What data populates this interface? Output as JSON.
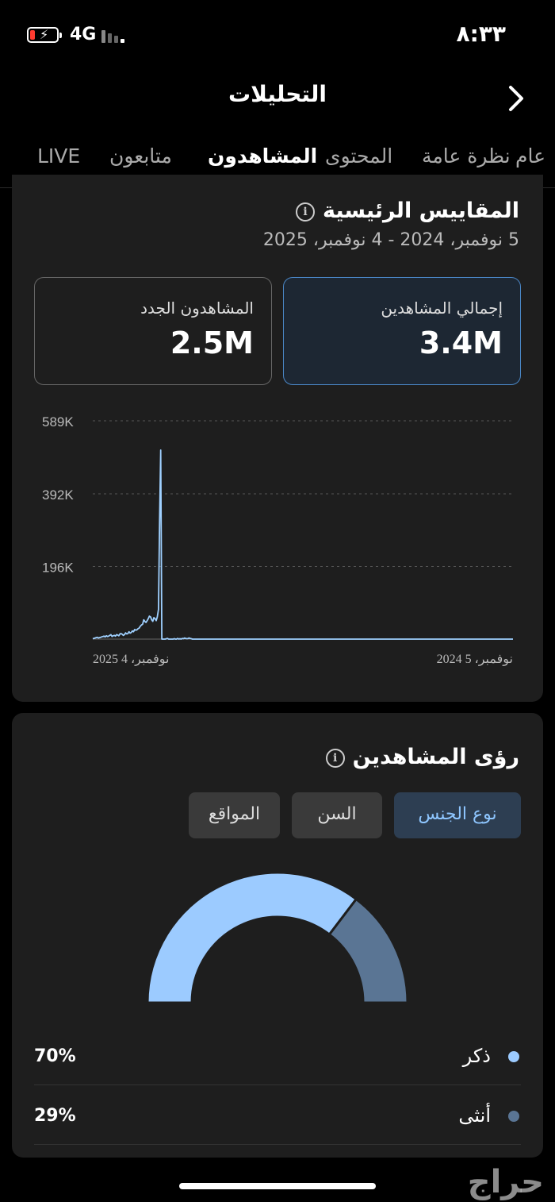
{
  "status": {
    "network": "4G",
    "time": "٨:٣٣"
  },
  "header": {
    "title": "التحليلات"
  },
  "tabs": [
    {
      "label": "عام"
    },
    {
      "label": "نظرة عامة"
    },
    {
      "label": "المحتوى"
    },
    {
      "label": "المشاهدون",
      "active": true
    },
    {
      "label": "متابعون"
    },
    {
      "label": "LIVE"
    }
  ],
  "metrics": {
    "title": "المقاييس الرئيسية",
    "date_range": "5 نوفمبر، 2024 - 4 نوفمبر، 2025",
    "cards": [
      {
        "label": "إجمالي المشاهدين",
        "value": "3.4M",
        "selected": true
      },
      {
        "label": "المشاهدون الجدد",
        "value": "2.5M",
        "selected": false
      }
    ]
  },
  "chart_data": {
    "type": "line",
    "title": "",
    "ylim": [
      0,
      589000
    ],
    "y_ticks": [
      {
        "value": 589000,
        "label": "589K"
      },
      {
        "value": 392000,
        "label": "392K"
      },
      {
        "value": 196000,
        "label": "196K"
      }
    ],
    "x_tick_labels": [
      "نوفمبر، 5 2024",
      "نوفمبر، 4 2025"
    ],
    "x_direction": "rtl",
    "color": "#9fd0ff",
    "series": [
      {
        "values": [
          0,
          0,
          0,
          0,
          0,
          0,
          0,
          0,
          0,
          0,
          0,
          0,
          0,
          0,
          0,
          0,
          0,
          0,
          0,
          0,
          0,
          0,
          0,
          0,
          0,
          0,
          0,
          0,
          0,
          0,
          0,
          0,
          0,
          0,
          0,
          0,
          0,
          0,
          0,
          0,
          0,
          0,
          0,
          0,
          0,
          0,
          0,
          0,
          0,
          0,
          0,
          0,
          0,
          0,
          0,
          0,
          0,
          0,
          0,
          0,
          0,
          0,
          0,
          0,
          0,
          0,
          0,
          0,
          0,
          0,
          0,
          0,
          0,
          0,
          0,
          0,
          0,
          0,
          0,
          0,
          0,
          0,
          0,
          0,
          0,
          0,
          0,
          0,
          0,
          0,
          0,
          0,
          0,
          0,
          0,
          0,
          0,
          0,
          0,
          0,
          0,
          0,
          0,
          0,
          0,
          0,
          0,
          0,
          0,
          0,
          0,
          0,
          0,
          0,
          0,
          0,
          0,
          0,
          0,
          0,
          0,
          0,
          0,
          0,
          0,
          0,
          0,
          0,
          0,
          0,
          0,
          0,
          0,
          0,
          0,
          0,
          0,
          0,
          0,
          0,
          0,
          0,
          0,
          0,
          0,
          0,
          0,
          0,
          0,
          0,
          0,
          0,
          0,
          0,
          0,
          0,
          0,
          0,
          0,
          0,
          0,
          0,
          0,
          0,
          0,
          0,
          0,
          0,
          0,
          0,
          0,
          0,
          0,
          0,
          0,
          0,
          0,
          0,
          0,
          0,
          0,
          0,
          0,
          0,
          0,
          0,
          0,
          0,
          0,
          0,
          0,
          0,
          0,
          0,
          0,
          0,
          0,
          0,
          0,
          0,
          0,
          0,
          0,
          0,
          0,
          0,
          0,
          0,
          0,
          0,
          0,
          0,
          0,
          0,
          0,
          0,
          0,
          0,
          0,
          0,
          0,
          0,
          0,
          0,
          0,
          0,
          0,
          0,
          0,
          0,
          0,
          0,
          0,
          0,
          0,
          0,
          0,
          0,
          0,
          0,
          0,
          0,
          0,
          0,
          0,
          0,
          0,
          0,
          0,
          0,
          0,
          0,
          0,
          0,
          0,
          0,
          0,
          0,
          0,
          0,
          0,
          0,
          0,
          0,
          0,
          0,
          0,
          0,
          0,
          0,
          0,
          0,
          0,
          0,
          0,
          0,
          0,
          0,
          0,
          0,
          0,
          0,
          0,
          0,
          1000,
          2000,
          3000,
          1500,
          1000,
          2000,
          3000,
          1000,
          2000,
          0,
          1000,
          0,
          2000,
          0,
          0,
          1000,
          0,
          0,
          0,
          0,
          0,
          2000,
          1000,
          0,
          0,
          0,
          0,
          510000,
          320000,
          80000,
          60000,
          50000,
          55000,
          58000,
          48000,
          52000,
          60000,
          62000,
          55000,
          50000,
          45000,
          48000,
          52000,
          40000,
          38000,
          35000,
          30000,
          28000,
          25000,
          24000,
          26000,
          20000,
          22000,
          18000,
          16000,
          20000,
          15000,
          14000,
          17000,
          12000,
          10000,
          13000,
          15000,
          14000,
          9000,
          11000,
          12000,
          8000,
          10000,
          9000,
          7000,
          12000,
          10000,
          8000,
          7000,
          9000,
          6000,
          8000,
          7000,
          6000,
          5000,
          4000,
          3000,
          5000,
          4000,
          3000,
          2000,
          1000
        ]
      }
    ]
  },
  "insights": {
    "title": "رؤى المشاهدين",
    "segments": [
      {
        "label": "نوع الجنس",
        "active": true
      },
      {
        "label": "السن",
        "active": false
      },
      {
        "label": "المواقع",
        "active": false
      }
    ],
    "gender": [
      {
        "label": "ذكر",
        "percent": 70,
        "percent_label": "70%",
        "color": "#9ccbff"
      },
      {
        "label": "أنثى",
        "percent": 29,
        "percent_label": "29%",
        "color": "#5a7594"
      }
    ]
  },
  "watermark": "حراج"
}
